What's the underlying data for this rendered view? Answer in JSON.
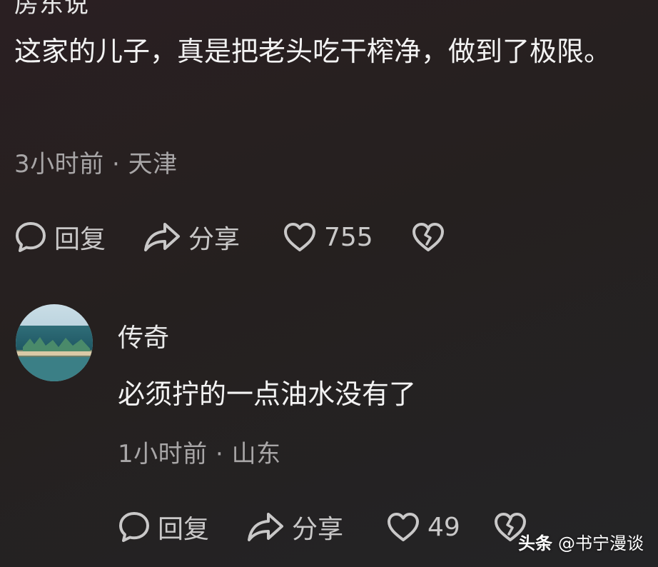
{
  "top_cut": {
    "username_partial": "房东说"
  },
  "comment1": {
    "text": "这家的儿子，真是把老头吃干榨净，做到了极限。",
    "time": "3小时前",
    "location": "天津",
    "reply_label": "回复",
    "share_label": "分享",
    "like_count": "755",
    "icons": [
      "reply-icon",
      "share-icon",
      "heart-icon",
      "broken-heart-icon"
    ]
  },
  "comment2": {
    "username": "传奇",
    "text": "必须拧的一点油水没有了",
    "time": "1小时前",
    "location": "山东",
    "reply_label": "回复",
    "share_label": "分享",
    "like_count": "49"
  },
  "watermark": {
    "brand": "头条",
    "handle": "@书宁漫谈"
  },
  "colors": {
    "text": "#f3f3f3",
    "meta": "#a8a6a7",
    "icon": "#c9c8c8"
  }
}
